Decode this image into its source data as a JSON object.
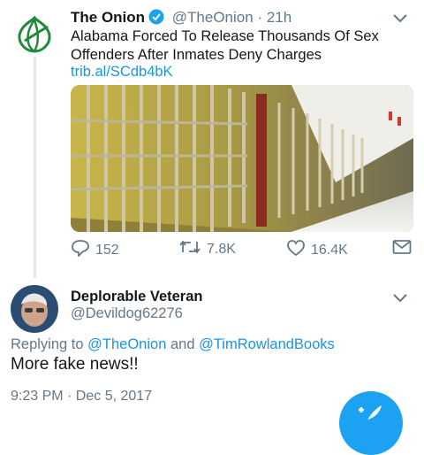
{
  "tweet": {
    "author_name": "The Onion",
    "handle": "@TheOnion",
    "separator": "·",
    "time": "21h",
    "text": "Alabama Forced To Release Thousands Of Sex Offenders After Inmates Deny Charges",
    "link": "trib.al/SCdb4bK",
    "stats": {
      "replies": "152",
      "retweets": "7.8K",
      "likes": "16.4K"
    },
    "icons": [
      "onion-logo-icon",
      "verified-icon",
      "chevron-down-icon",
      "image-prison-cells",
      "reply-icon",
      "retweet-icon",
      "like-icon",
      "message-icon"
    ]
  },
  "reply": {
    "author_name": "Deplorable Veteran",
    "handle": "@Devildog62276",
    "replying_prefix": "Replying to",
    "mention_1": "@TheOnion",
    "conjunction": "and",
    "mention_2": "@TimRowlandBooks",
    "text": "More fake news!!",
    "timestamp": "9:23 PM · Dec 5, 2017",
    "icons": [
      "avatar",
      "chevron-down-icon"
    ]
  },
  "compose": {
    "icon": "compose-tweet-icon"
  },
  "colors": {
    "accent": "#1da1f2",
    "link": "#1b95e0",
    "muted": "#657786",
    "onion_green": "#1f8a3b"
  }
}
